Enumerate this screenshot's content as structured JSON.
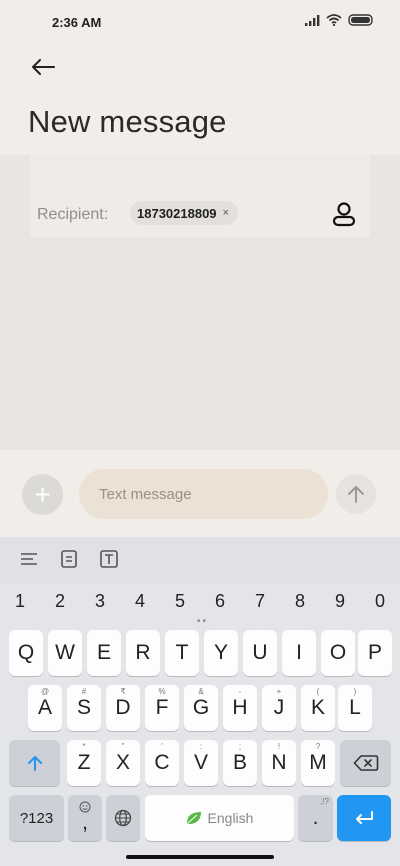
{
  "status_bar": {
    "time": "2:36 AM"
  },
  "header": {
    "title": "New message"
  },
  "recipient": {
    "label": "Recipient:",
    "chip_number": "18730218809",
    "chip_remove": "×"
  },
  "compose": {
    "placeholder": "Text message",
    "add_symbol": "+"
  },
  "keyboard": {
    "numbers": [
      "1",
      "2",
      "3",
      "4",
      "5",
      "6",
      "7",
      "8",
      "9",
      "0"
    ],
    "row1": [
      "Q",
      "W",
      "E",
      "R",
      "T",
      "Y",
      "U",
      "I",
      "O",
      "P"
    ],
    "row2": [
      "A",
      "S",
      "D",
      "F",
      "G",
      "H",
      "J",
      "K",
      "L"
    ],
    "row2_hints": [
      "@",
      "#",
      "₹",
      "%",
      "&",
      "-",
      "+",
      "(",
      ")"
    ],
    "row3": [
      "Z",
      "X",
      "C",
      "V",
      "B",
      "N",
      "M"
    ],
    "row3_hints": [
      "*",
      "\"",
      "'",
      ":",
      ";",
      "!",
      "?"
    ],
    "symbols_key": "?123",
    "comma_key": ",",
    "space_label": "English",
    "period_key": ".",
    "period_hint": ",!?"
  },
  "colors": {
    "accent": "#2196f3",
    "leaf": "#5bb648"
  }
}
